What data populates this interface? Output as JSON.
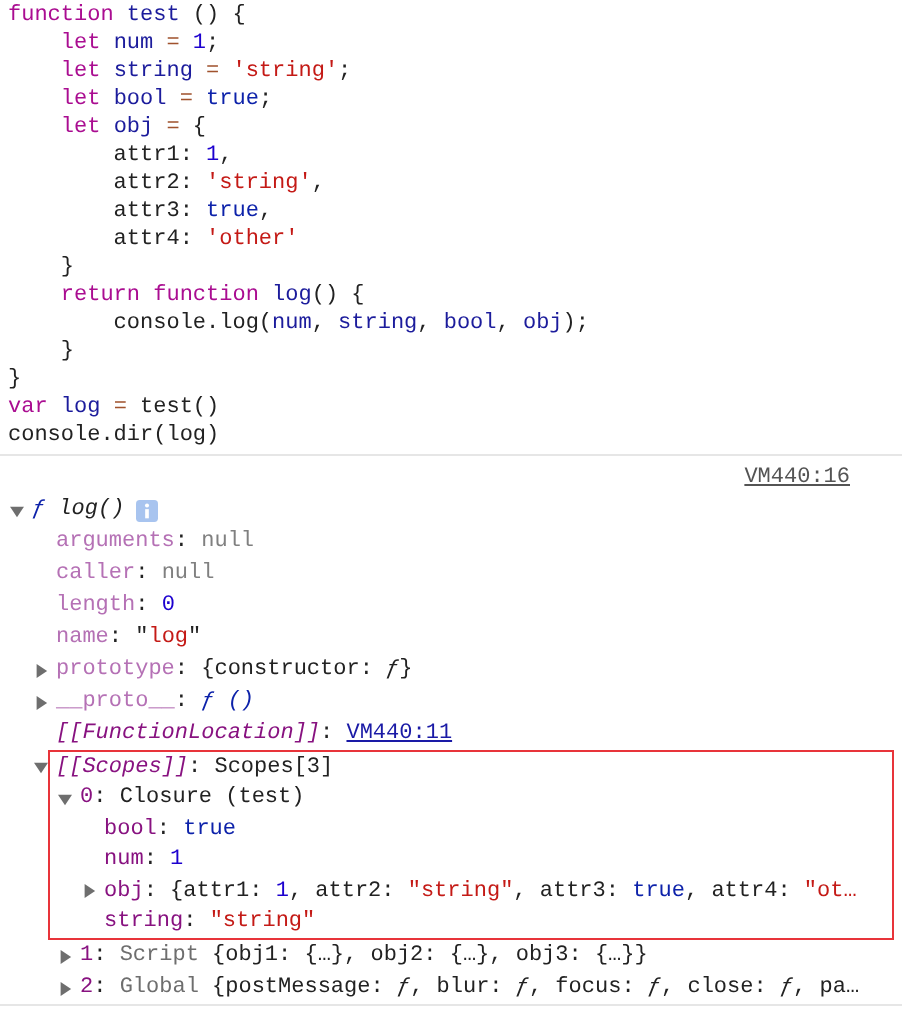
{
  "console": {
    "code_lines": [
      [
        {
          "kind": "keyword",
          "text": "function "
        },
        {
          "kind": "def",
          "text": "test"
        },
        {
          "kind": "plain",
          "text": " () {"
        }
      ],
      [
        {
          "kind": "keyword",
          "text": "    let "
        },
        {
          "kind": "def",
          "text": "num "
        },
        {
          "kind": "operator",
          "text": "= "
        },
        {
          "kind": "number",
          "text": "1"
        },
        {
          "kind": "plain",
          "text": ";"
        }
      ],
      [
        {
          "kind": "keyword",
          "text": "    let "
        },
        {
          "kind": "def",
          "text": "string "
        },
        {
          "kind": "operator",
          "text": "= "
        },
        {
          "kind": "string",
          "text": "'string'"
        },
        {
          "kind": "plain",
          "text": ";"
        }
      ],
      [
        {
          "kind": "keyword",
          "text": "    let "
        },
        {
          "kind": "def",
          "text": "bool "
        },
        {
          "kind": "operator",
          "text": "= "
        },
        {
          "kind": "atom",
          "text": "true"
        },
        {
          "kind": "plain",
          "text": ";"
        }
      ],
      [
        {
          "kind": "keyword",
          "text": "    let "
        },
        {
          "kind": "def",
          "text": "obj "
        },
        {
          "kind": "operator",
          "text": "="
        },
        {
          "kind": "plain",
          "text": " {"
        }
      ],
      [
        {
          "kind": "plain",
          "text": "        attr1: "
        },
        {
          "kind": "number",
          "text": "1"
        },
        {
          "kind": "plain",
          "text": ","
        }
      ],
      [
        {
          "kind": "plain",
          "text": "        attr2: "
        },
        {
          "kind": "string",
          "text": "'string'"
        },
        {
          "kind": "plain",
          "text": ","
        }
      ],
      [
        {
          "kind": "plain",
          "text": "        attr3: "
        },
        {
          "kind": "atom",
          "text": "true"
        },
        {
          "kind": "plain",
          "text": ","
        }
      ],
      [
        {
          "kind": "plain",
          "text": "        attr4: "
        },
        {
          "kind": "string",
          "text": "'other'"
        }
      ],
      [
        {
          "kind": "plain",
          "text": "    }"
        }
      ],
      [
        {
          "kind": "keyword",
          "text": "    return function "
        },
        {
          "kind": "def",
          "text": "log"
        },
        {
          "kind": "plain",
          "text": "() {"
        }
      ],
      [
        {
          "kind": "plain",
          "text": "        console.log("
        },
        {
          "kind": "var",
          "text": "num"
        },
        {
          "kind": "plain",
          "text": ", "
        },
        {
          "kind": "var",
          "text": "string"
        },
        {
          "kind": "plain",
          "text": ", "
        },
        {
          "kind": "var",
          "text": "bool"
        },
        {
          "kind": "plain",
          "text": ", "
        },
        {
          "kind": "var",
          "text": "obj"
        },
        {
          "kind": "plain",
          "text": ");"
        }
      ],
      [
        {
          "kind": "plain",
          "text": "    }"
        }
      ],
      [
        {
          "kind": "plain",
          "text": "}"
        }
      ],
      [
        {
          "kind": "keyword",
          "text": "var "
        },
        {
          "kind": "def",
          "text": "log "
        },
        {
          "kind": "operator",
          "text": "="
        },
        {
          "kind": "plain",
          "text": " test()"
        }
      ],
      [
        {
          "kind": "plain",
          "text": "console.dir(log)"
        }
      ]
    ],
    "source_link": "VM440:16",
    "tree": {
      "value": [
        {
          "kind": "func",
          "text": "ƒ "
        },
        {
          "kind": "italic",
          "text": "log()"
        }
      ],
      "expanded": true,
      "children": [
        {
          "key": "arguments",
          "separator": ":",
          "dimmed": true,
          "internal": false,
          "value": [
            {
              "kind": "null",
              "text": "null"
            }
          ]
        },
        {
          "key": "caller",
          "separator": ":",
          "dimmed": true,
          "internal": false,
          "value": [
            {
              "kind": "null",
              "text": "null"
            }
          ]
        },
        {
          "key": "length",
          "separator": ":",
          "dimmed": true,
          "internal": false,
          "value": [
            {
              "kind": "number",
              "text": "0"
            }
          ]
        },
        {
          "key": "name",
          "separator": ":",
          "dimmed": true,
          "internal": false,
          "value": [
            {
              "kind": "plain",
              "text": "\""
            },
            {
              "kind": "string",
              "text": "log"
            },
            {
              "kind": "plain",
              "text": "\""
            }
          ]
        },
        {
          "key": "prototype",
          "separator": ":",
          "dimmed": true,
          "internal": false,
          "expanded": false,
          "value": [
            {
              "kind": "plain",
              "text": "{constructor: "
            },
            {
              "kind": "italic",
              "text": "ƒ"
            },
            {
              "kind": "plain",
              "text": "}"
            }
          ]
        },
        {
          "key": "__proto__",
          "separator": ":",
          "dimmed": true,
          "internal": false,
          "expanded": false,
          "value": [
            {
              "kind": "func",
              "text": "ƒ ()"
            }
          ]
        },
        {
          "key": "[[FunctionLocation]]",
          "separator": ":",
          "dimmed": false,
          "internal": true,
          "value": [
            {
              "kind": "link",
              "text": "VM440:11"
            }
          ]
        },
        {
          "key": "[[Scopes]]",
          "separator": ":",
          "dimmed": false,
          "internal": true,
          "expanded": true,
          "highlight": true,
          "value": [
            {
              "kind": "plain",
              "text": "Scopes[3]"
            }
          ],
          "children": [
            {
              "key": "0",
              "separator": ":",
              "dimmed": false,
              "internal": false,
              "expanded": true,
              "highlight": true,
              "value": [
                {
                  "kind": "plain",
                  "text": "Closure (test)"
                }
              ],
              "children": [
                {
                  "key": "bool",
                  "separator": ":",
                  "dimmed": false,
                  "internal": false,
                  "value": [
                    {
                      "kind": "atom",
                      "text": "true"
                    }
                  ]
                },
                {
                  "key": "num",
                  "separator": ":",
                  "dimmed": false,
                  "internal": false,
                  "value": [
                    {
                      "kind": "number",
                      "text": "1"
                    }
                  ]
                },
                {
                  "key": "obj",
                  "separator": ":",
                  "dimmed": false,
                  "internal": false,
                  "expanded": false,
                  "value": [
                    {
                      "kind": "plain",
                      "text": "{attr1: "
                    },
                    {
                      "kind": "number",
                      "text": "1"
                    },
                    {
                      "kind": "plain",
                      "text": ", attr2: "
                    },
                    {
                      "kind": "string",
                      "text": "\"string\""
                    },
                    {
                      "kind": "plain",
                      "text": ", attr3: "
                    },
                    {
                      "kind": "atom",
                      "text": "true"
                    },
                    {
                      "kind": "plain",
                      "text": ", attr4: "
                    },
                    {
                      "kind": "string",
                      "text": "\"ot…"
                    }
                  ]
                },
                {
                  "key": "string",
                  "separator": ":",
                  "dimmed": false,
                  "internal": false,
                  "value": [
                    {
                      "kind": "string",
                      "text": "\"string\""
                    }
                  ]
                }
              ]
            },
            {
              "key": "1",
              "separator": ":",
              "dimmed": false,
              "internal": false,
              "expanded": false,
              "highlight": false,
              "value": [
                {
                  "kind": "preview",
                  "text": "Script"
                },
                {
                  "kind": "plain",
                  "text": " {obj1: {…}, obj2: {…}, obj3: {…}}"
                }
              ]
            },
            {
              "key": "2",
              "separator": ":",
              "dimmed": false,
              "internal": false,
              "expanded": false,
              "highlight": false,
              "value": [
                {
                  "kind": "preview",
                  "text": "Global"
                },
                {
                  "kind": "plain",
                  "text": " {postMessage: "
                },
                {
                  "kind": "italic",
                  "text": "ƒ"
                },
                {
                  "kind": "plain",
                  "text": ", blur: "
                },
                {
                  "kind": "italic",
                  "text": "ƒ"
                },
                {
                  "kind": "plain",
                  "text": ", focus: "
                },
                {
                  "kind": "italic",
                  "text": "ƒ"
                },
                {
                  "kind": "plain",
                  "text": ", close: "
                },
                {
                  "kind": "italic",
                  "text": "ƒ"
                },
                {
                  "kind": "plain",
                  "text": ", pa…"
                }
              ]
            }
          ]
        }
      ]
    }
  }
}
